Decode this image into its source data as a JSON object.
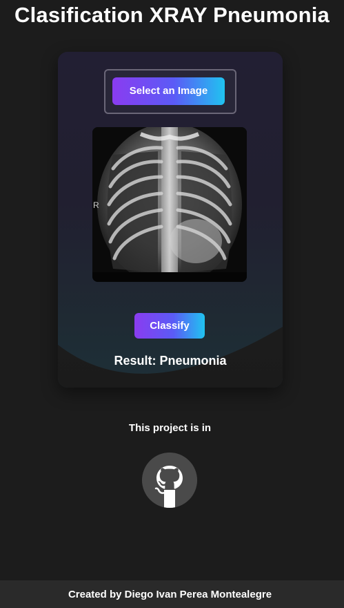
{
  "header": {
    "title": "Clasification XRAY Pneumonia"
  },
  "card": {
    "select_button_label": "Select an Image",
    "xray_marker": "R",
    "classify_button_label": "Classify",
    "result_text": "Result: Pneumonia"
  },
  "project": {
    "text": "This project is in",
    "icon": "github-icon"
  },
  "footer": {
    "credit": "Created by  Diego Ivan Perea Montealegre"
  },
  "colors": {
    "background": "#1c1c1c",
    "card_top": "#221f33",
    "card_bottom": "#1d3038",
    "button_gradient_start": "#8a3cf0",
    "button_gradient_end": "#20c3f0",
    "footer_bg": "#2a2a2a",
    "github_circle": "#4a4a4a"
  }
}
